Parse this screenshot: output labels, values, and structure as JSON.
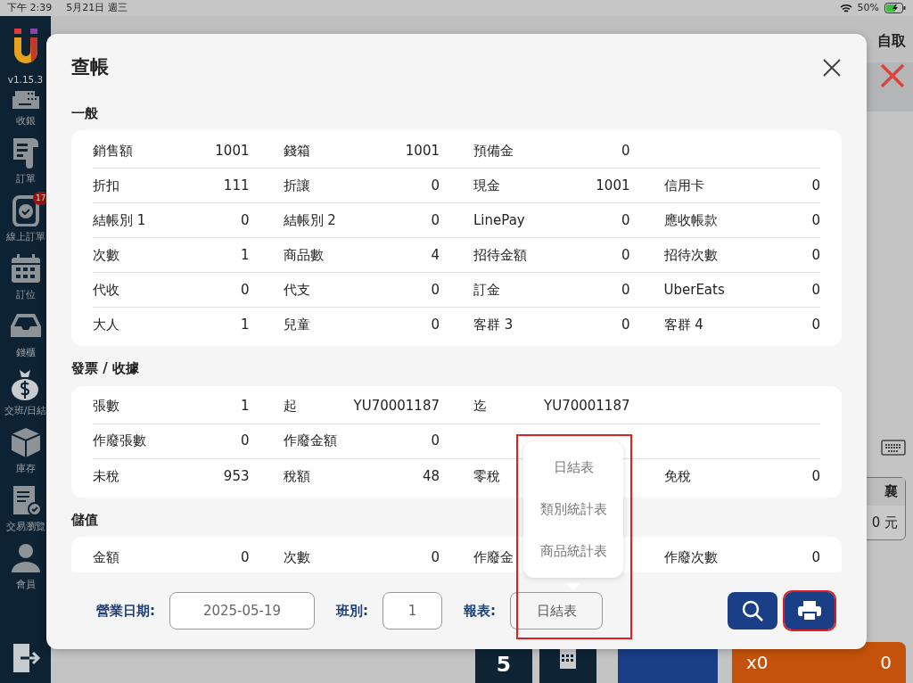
{
  "status_bar": {
    "time": "下午 2:39",
    "date": "5月21日 週三",
    "battery": "50%"
  },
  "sidebar": {
    "version": "v1.15.3",
    "items": [
      {
        "label": "收銀"
      },
      {
        "label": "訂單"
      },
      {
        "label": "線上訂單",
        "badge": "17"
      },
      {
        "label": "訂位"
      },
      {
        "label": "錢櫃"
      },
      {
        "label": "交班/日結"
      },
      {
        "label": "庫存"
      },
      {
        "label": "交易瀏覽"
      },
      {
        "label": "會員"
      }
    ]
  },
  "background": {
    "order_type": "自取",
    "panel_title": "襄",
    "panel_amount": "0 元",
    "keypad_key": "5",
    "checkout_count": "x0",
    "checkout_total": "0"
  },
  "dialog": {
    "title": "查帳",
    "sections": [
      {
        "title": "一般",
        "rows": [
          [
            {
              "label": "銷售額",
              "value": "1001"
            },
            {
              "label": "錢箱",
              "value": "1001"
            },
            {
              "label": "預備金",
              "value": "0"
            }
          ],
          [
            {
              "label": "折扣",
              "value": "111"
            },
            {
              "label": "折讓",
              "value": "0"
            },
            {
              "label": "現金",
              "value": "1001"
            },
            {
              "label": "信用卡",
              "value": "0"
            }
          ],
          [
            {
              "label": "結帳別 1",
              "value": "0"
            },
            {
              "label": "結帳別 2",
              "value": "0"
            },
            {
              "label": "LinePay",
              "value": "0"
            },
            {
              "label": "應收帳款",
              "value": "0"
            }
          ],
          [
            {
              "label": "次數",
              "value": "1"
            },
            {
              "label": "商品數",
              "value": "4"
            },
            {
              "label": "招待金額",
              "value": "0"
            },
            {
              "label": "招待次數",
              "value": "0"
            }
          ],
          [
            {
              "label": "代收",
              "value": "0"
            },
            {
              "label": "代支",
              "value": "0"
            },
            {
              "label": "訂金",
              "value": "0"
            },
            {
              "label": "UberEats",
              "value": "0"
            }
          ],
          [
            {
              "label": "大人",
              "value": "1"
            },
            {
              "label": "兒童",
              "value": "0"
            },
            {
              "label": "客群 3",
              "value": "0"
            },
            {
              "label": "客群 4",
              "value": "0"
            }
          ]
        ]
      },
      {
        "title": "發票 / 收據",
        "rows": [
          [
            {
              "label": "張數",
              "value": "1"
            },
            {
              "label": "起",
              "value": "YU70001187"
            },
            {
              "label": "迄",
              "value": "YU70001187"
            }
          ],
          [
            {
              "label": "作廢張數",
              "value": "0"
            },
            {
              "label": "作廢金額",
              "value": "0"
            }
          ],
          [
            {
              "label": "未稅",
              "value": "953"
            },
            {
              "label": "稅額",
              "value": "48"
            },
            {
              "label": "零稅"
            },
            {
              "label": "免稅",
              "value": "0"
            }
          ]
        ]
      },
      {
        "title": "儲值",
        "rows": [
          [
            {
              "label": "金額",
              "value": "0"
            },
            {
              "label": "次數",
              "value": "0"
            },
            {
              "label": "作廢金"
            },
            {
              "label": "作廢次數",
              "value": "0"
            }
          ]
        ]
      }
    ],
    "footer": {
      "date_label": "營業日期:",
      "date_value": "2025-05-19",
      "shift_label": "班別:",
      "shift_value": "1",
      "report_label": "報表:",
      "report_value": "日結表",
      "report_highlighted": true,
      "print_highlighted": true
    },
    "report_menu": {
      "options": [
        "日結表",
        "類別統計表",
        "商品統計表"
      ]
    }
  }
}
